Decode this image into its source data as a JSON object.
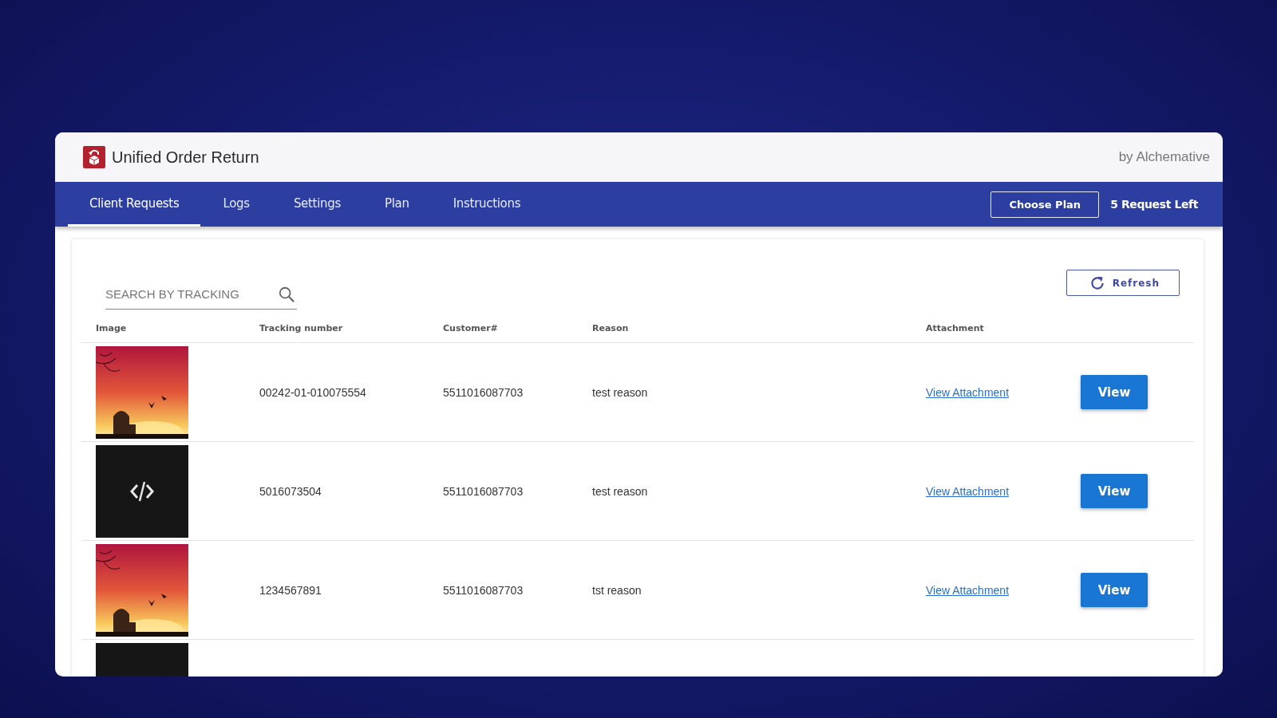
{
  "app": {
    "title": "Unified Order Return",
    "vendor": "by Alchemative"
  },
  "tabs": [
    {
      "label": "Client Requests",
      "selected": true
    },
    {
      "label": "Logs",
      "selected": false
    },
    {
      "label": "Settings",
      "selected": false
    },
    {
      "label": "Plan",
      "selected": false
    },
    {
      "label": "Instructions",
      "selected": false
    }
  ],
  "plan_button": "Choose Plan",
  "requests_left": "5 Request Left",
  "search": {
    "placeholder": "SEARCH BY TRACKING"
  },
  "refresh_button": "Refresh",
  "table": {
    "columns": [
      "Image",
      "Tracking number",
      "Customer#",
      "Reason",
      "Attachment"
    ],
    "rows": [
      {
        "image": {
          "kind": "picture"
        },
        "tracking": "00242-01-010075554",
        "customer": "5511016087703",
        "reason": "test reason",
        "attachment": "View Attachment",
        "action": "View"
      },
      {
        "image": {
          "kind": "picture"
        },
        "tracking": "5016073504",
        "customer": "5511016087703",
        "reason": "test reason",
        "attachment": "View Attachment",
        "action": "View"
      },
      {
        "image": {
          "kind": "picture"
        },
        "tracking": "1234567891",
        "customer": "5511016087703",
        "reason": "tst reason",
        "attachment": "View Attachment",
        "action": "View"
      },
      {
        "image": {
          "kind": "picture"
        }
      }
    ]
  }
}
